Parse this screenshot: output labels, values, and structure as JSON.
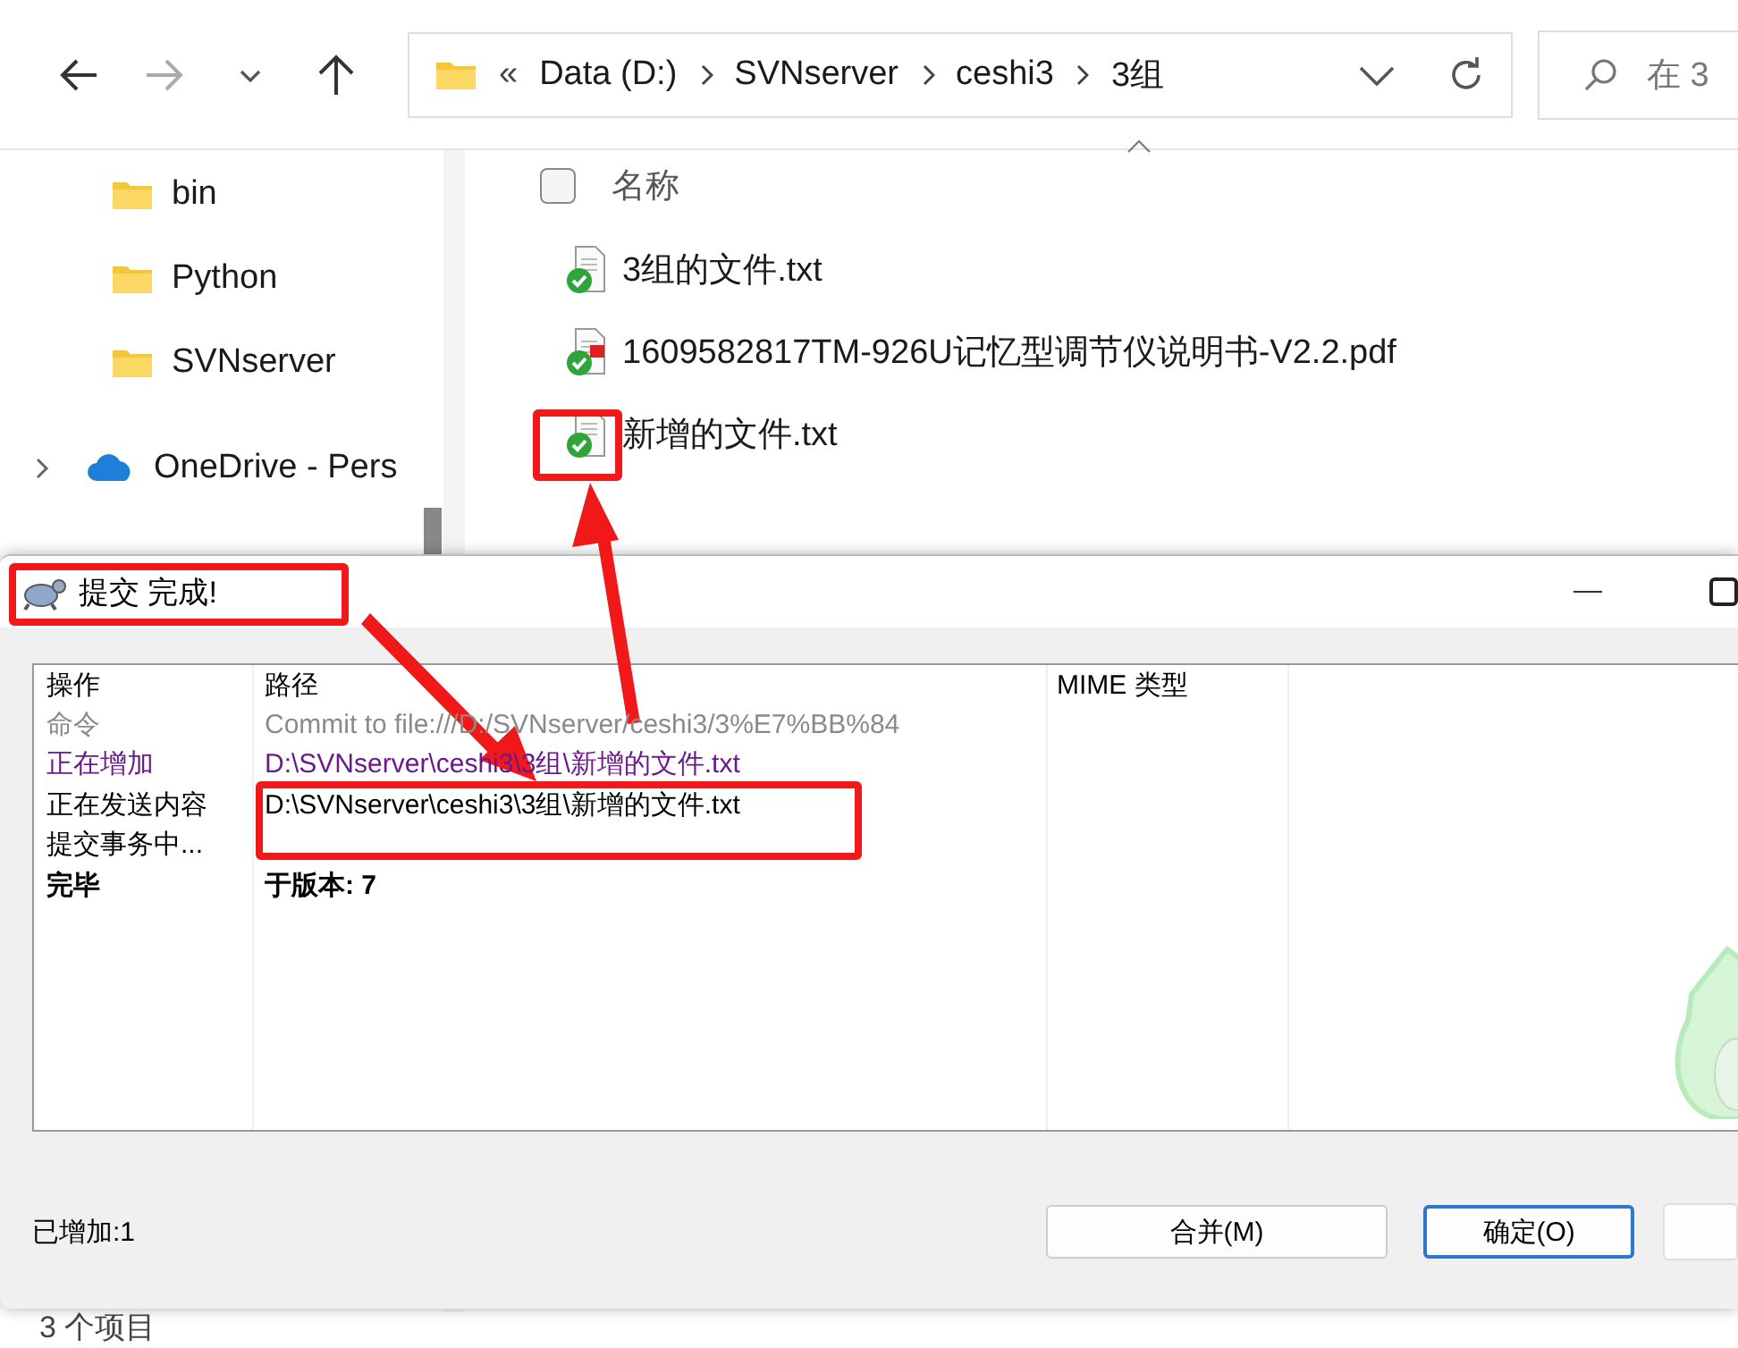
{
  "explorer": {
    "address": {
      "overflow": "«",
      "crumbs": [
        "Data (D:)",
        "SVNserver",
        "ceshi3",
        "3组"
      ]
    },
    "search": {
      "placeholder": "在 3"
    },
    "sidebar": {
      "items": [
        {
          "label": "bin",
          "kind": "folder"
        },
        {
          "label": "Python",
          "kind": "folder"
        },
        {
          "label": "SVNserver",
          "kind": "folder"
        },
        {
          "label": "OneDrive - Pers",
          "kind": "cloud",
          "expanded": false
        }
      ]
    },
    "select_all": {
      "checked": false
    },
    "columns": [
      "名称"
    ],
    "files": [
      {
        "name": "3组的文件.txt",
        "kind": "txt"
      },
      {
        "name": "1609582817TM-926U记忆型调节仪说明书-V2.2.pdf",
        "kind": "pdf"
      },
      {
        "name": "新增的文件.txt",
        "kind": "txt"
      }
    ],
    "status_bar": "3 个项目"
  },
  "dialog": {
    "title": "提交 完成!",
    "columns": [
      "操作",
      "路径",
      "MIME 类型"
    ],
    "rows": [
      {
        "kind": "command",
        "action": "命令",
        "path": "Commit to file:///D:/SVNserver/ceshi3/3%E7%BB%84"
      },
      {
        "kind": "added",
        "action": "正在增加",
        "path": "D:\\SVNserver\\ceshi3\\3组\\新增的文件.txt"
      },
      {
        "kind": "normal",
        "action": "正在发送内容",
        "path": "D:\\SVNserver\\ceshi3\\3组\\新增的文件.txt"
      },
      {
        "kind": "normal",
        "action": "提交事务中..."
      },
      {
        "kind": "done",
        "action": "完毕",
        "path": "于版本: 7"
      }
    ],
    "summary": "已增加:1",
    "buttons": [
      {
        "label": "合并(M)",
        "focused": false
      },
      {
        "label": "确定(O)",
        "focused": true
      }
    ]
  }
}
